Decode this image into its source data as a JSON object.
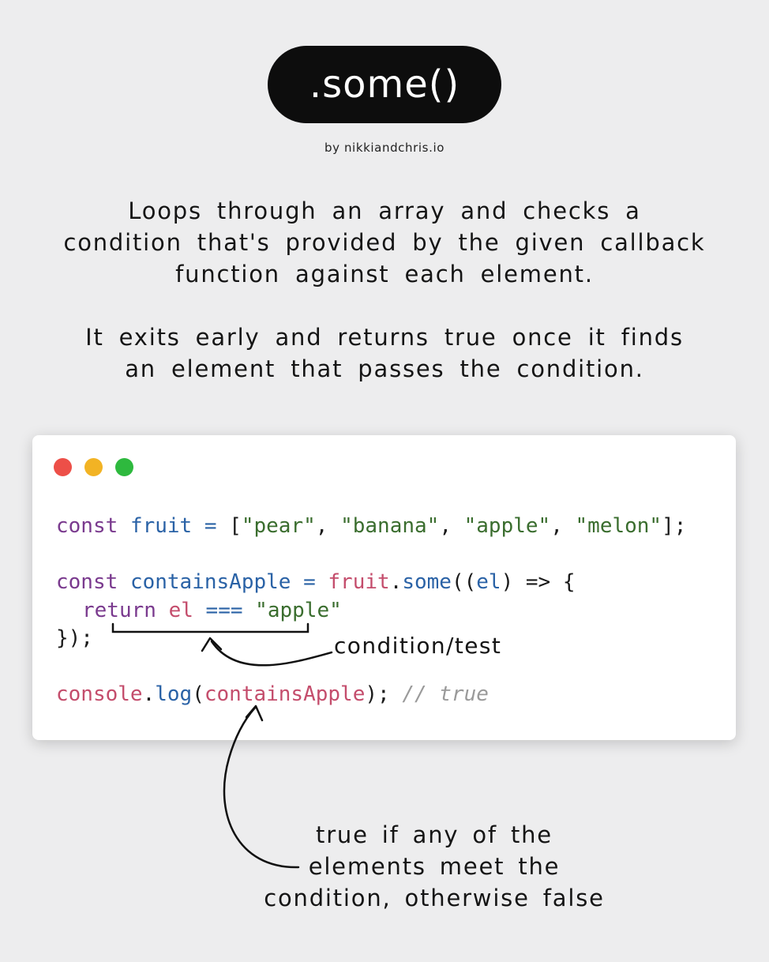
{
  "title": ".some()",
  "byline": "by nikkiandchris.io",
  "description": {
    "line1": "Loops through an array and checks a",
    "line2": "condition that's provided by the given callback",
    "line3": "function against each element.",
    "line4": "It exits early and returns true once it finds",
    "line5": "an element that passes the condition."
  },
  "code": {
    "line1": {
      "kw": "const",
      "var": "fruit",
      "eq": " = ",
      "rest": "[",
      "s1": "\"pear\"",
      "c1": ", ",
      "s2": "\"banana\"",
      "c2": ", ",
      "s3": "\"apple\"",
      "c3": ", ",
      "s4": "\"melon\"",
      "end": "];"
    },
    "line2": {
      "kw": "const",
      "var": "containsApple",
      "eq": " = ",
      "obj": "fruit",
      "dot": ".",
      "method": "some",
      "args": "((",
      "param": "el",
      "arrow": ") => {"
    },
    "line3": {
      "kw": "return",
      "var": "el",
      "op": " === ",
      "str": "\"apple\""
    },
    "line4": "});",
    "line5": {
      "obj": "console",
      "dot": ".",
      "method": "log",
      "open": "(",
      "arg": "containsApple",
      "close": ");",
      "comment": "// true"
    }
  },
  "annotations": {
    "condition": "condition/test",
    "result_line1": "true if any of the",
    "result_line2": "elements meet the",
    "result_line3": "condition, otherwise false"
  },
  "colors": {
    "background": "#ededee",
    "pill": "#0d0d0d",
    "dot_red": "#ed4f48",
    "dot_yellow": "#f2b324",
    "dot_green": "#2eb93e",
    "keyword": "#7a3a8e",
    "identifier": "#2a62a6",
    "string": "#3a6d2e",
    "function": "#c44d6c",
    "comment": "#9a9a9a"
  }
}
